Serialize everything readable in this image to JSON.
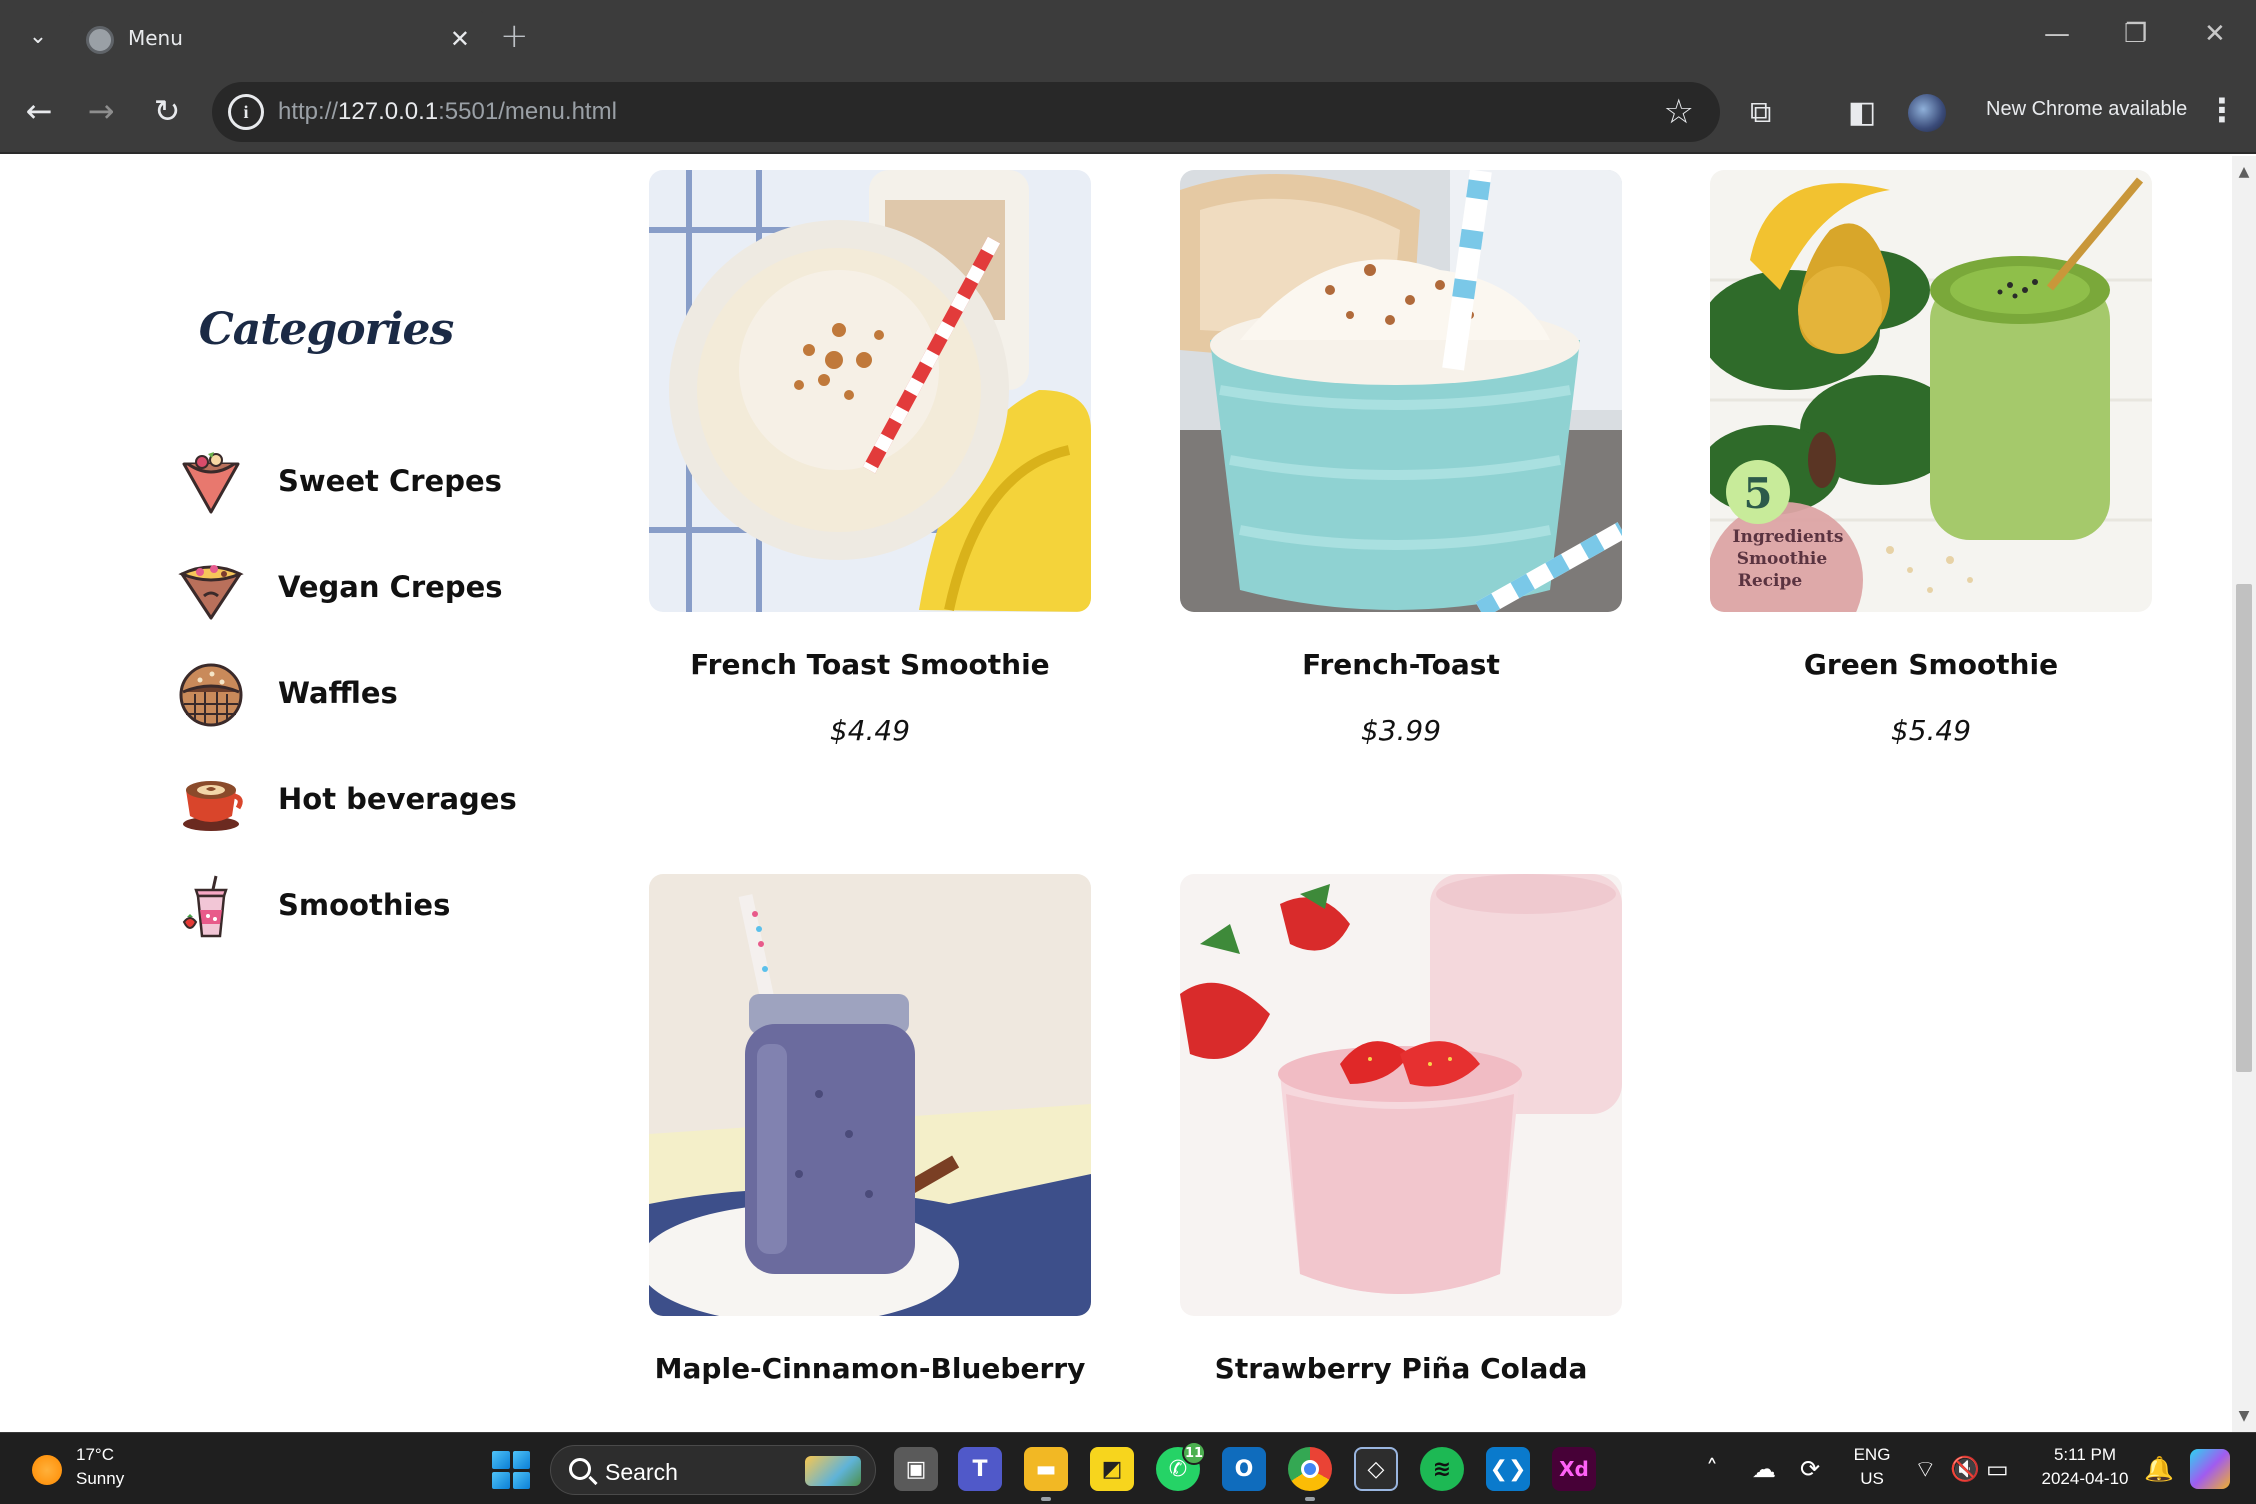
{
  "browser": {
    "tab_title": "Menu",
    "url_scheme": "http://",
    "url_host": "127.0.0.1",
    "url_rest": ":5501/menu.html",
    "update_label": "New Chrome available"
  },
  "sidebar": {
    "title": "Categories",
    "items": [
      {
        "label": "Sweet Crepes",
        "icon": "crepe-icon"
      },
      {
        "label": "Vegan Crepes",
        "icon": "vegan-crepe-icon"
      },
      {
        "label": "Waffles",
        "icon": "waffle-icon"
      },
      {
        "label": "Hot beverages",
        "icon": "coffee-cup-icon"
      },
      {
        "label": "Smoothies",
        "icon": "smoothie-cup-icon"
      }
    ]
  },
  "products": [
    {
      "name": "French Toast Smoothie",
      "price": "$4.49"
    },
    {
      "name": "French-Toast",
      "price": "$3.99"
    },
    {
      "name": "Green Smoothie",
      "price": "$5.49",
      "image_text_number": "5",
      "image_text": "Ingredients Smoothie Recipe"
    },
    {
      "name": "Maple-Cinnamon-Blueberry"
    },
    {
      "name": "Strawberry Piña Colada"
    }
  ],
  "taskbar": {
    "weather_temp": "17°C",
    "weather_condition": "Sunny",
    "search_label": "Search",
    "whatsapp_badge": "11",
    "xd_label": "Xd",
    "language": "ENG",
    "region": "US",
    "time": "5:11 PM",
    "date": "2024-04-10"
  }
}
